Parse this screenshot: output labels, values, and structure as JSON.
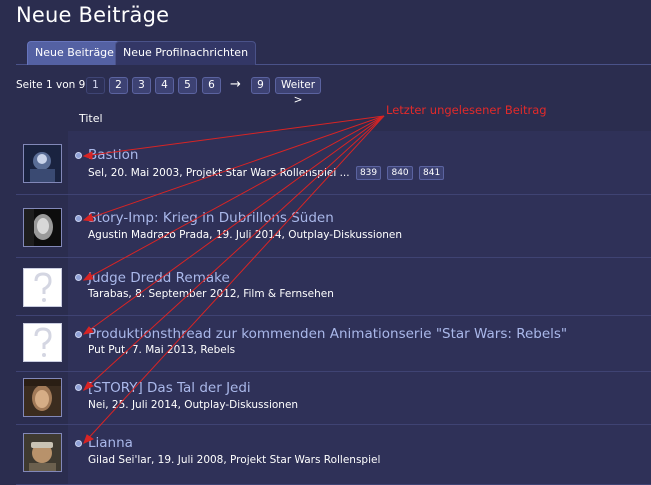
{
  "page": {
    "title": "Neue Beiträge"
  },
  "tabs": [
    {
      "label": "Neue Beiträge",
      "active": true
    },
    {
      "label": "Neue Profilnachrichten",
      "active": false
    }
  ],
  "pagination": {
    "label": "Seite 1 von 9",
    "pages": [
      "1",
      "2",
      "3",
      "4",
      "5",
      "6"
    ],
    "arrow": "→",
    "last": "9",
    "next": "Weiter >"
  },
  "list": {
    "column_title": "Titel",
    "threads": [
      {
        "title": "Bastion",
        "meta": "Sel, 20. Mai 2003, Projekt Star Wars Rollenspiel ...",
        "pages": [
          "839",
          "840",
          "841"
        ],
        "avatar": "photo"
      },
      {
        "title": "Story-Imp: Krieg in Dubrillons Süden",
        "meta": "Agustin Madrazo Prada, 19. Juli 2014, Outplay-Diskussionen",
        "pages": [],
        "avatar": "photo"
      },
      {
        "title": "Judge Dredd Remake",
        "meta": "Tarabas, 8. September 2012, Film & Fernsehen",
        "pages": [],
        "avatar": "placeholder"
      },
      {
        "title": "Produktionsthread zur kommenden Animationserie \"Star Wars: Rebels\"",
        "meta": "Put Put, 7. Mai 2013, Rebels",
        "pages": [],
        "avatar": "placeholder"
      },
      {
        "title": "[STORY] Das Tal der Jedi",
        "meta": "Nei, 25. Juli 2014, Outplay-Diskussionen",
        "pages": [],
        "avatar": "photo"
      },
      {
        "title": "Lianna",
        "meta": "Gilad Sei'lar, 19. Juli 2008, Projekt Star Wars Rollenspiel",
        "pages": [],
        "avatar": "photo"
      }
    ]
  },
  "annotation": {
    "label": "Letzter ungelesener Beitrag",
    "color": "#e22a2a"
  },
  "colors": {
    "background": "#2b2d4f",
    "row": "#2f3158",
    "title_link": "#aab8ea",
    "active_tab": "#5461a3"
  }
}
